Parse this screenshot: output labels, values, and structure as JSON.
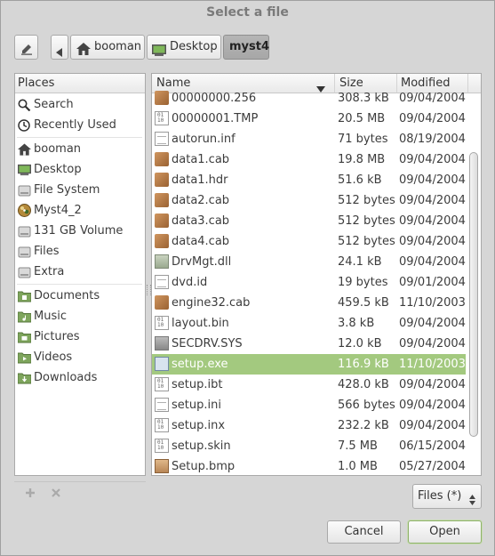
{
  "window": {
    "title": "Select a file"
  },
  "pathbar": {
    "edit_icon": "pencil-icon",
    "back_icon": "left-arrow-icon",
    "crumbs": [
      {
        "label": "booman",
        "icon": "home-icon"
      },
      {
        "label": "Desktop",
        "icon": "desktop-icon"
      },
      {
        "label": "myst4",
        "icon": ""
      }
    ]
  },
  "places": {
    "header": "Places",
    "items": [
      {
        "label": "Search",
        "icon": "search-icon"
      },
      {
        "label": "Recently Used",
        "icon": "clock-icon"
      },
      {
        "label": "booman",
        "icon": "home-icon"
      },
      {
        "label": "Desktop",
        "icon": "desktop-icon"
      },
      {
        "label": "File System",
        "icon": "drive-icon"
      },
      {
        "label": "Myst4_2",
        "icon": "disc-icon"
      },
      {
        "label": "131 GB Volume",
        "icon": "drive-icon"
      },
      {
        "label": "Files",
        "icon": "drive-icon"
      },
      {
        "label": "Extra",
        "icon": "drive-icon"
      },
      {
        "label": "Documents",
        "icon": "documents-folder-icon"
      },
      {
        "label": "Music",
        "icon": "music-folder-icon"
      },
      {
        "label": "Pictures",
        "icon": "pictures-folder-icon"
      },
      {
        "label": "Videos",
        "icon": "videos-folder-icon"
      },
      {
        "label": "Downloads",
        "icon": "downloads-folder-icon"
      }
    ],
    "add_icon": "plus-icon",
    "remove_icon": "x-icon"
  },
  "files": {
    "columns": {
      "name": "Name",
      "size": "Size",
      "modified": "Modified"
    },
    "sort_icon": "sort-down-icon",
    "rows": [
      {
        "name": "00000000.256",
        "size": "308.3 kB",
        "modified": "09/04/2004",
        "icon": "archive-icon"
      },
      {
        "name": "00000001.TMP",
        "size": "20.5 MB",
        "modified": "09/04/2004",
        "icon": "binary-file-icon"
      },
      {
        "name": "autorun.inf",
        "size": "71 bytes",
        "modified": "08/19/2004",
        "icon": "text-file-icon"
      },
      {
        "name": "data1.cab",
        "size": "19.8 MB",
        "modified": "09/04/2004",
        "icon": "archive-icon"
      },
      {
        "name": "data1.hdr",
        "size": "51.6 kB",
        "modified": "09/04/2004",
        "icon": "archive-icon"
      },
      {
        "name": "data2.cab",
        "size": "512 bytes",
        "modified": "09/04/2004",
        "icon": "archive-icon"
      },
      {
        "name": "data3.cab",
        "size": "512 bytes",
        "modified": "09/04/2004",
        "icon": "archive-icon"
      },
      {
        "name": "data4.cab",
        "size": "512 bytes",
        "modified": "09/04/2004",
        "icon": "archive-icon"
      },
      {
        "name": "DrvMgt.dll",
        "size": "24.1 kB",
        "modified": "09/04/2004",
        "icon": "library-file-icon"
      },
      {
        "name": "dvd.id",
        "size": "19 bytes",
        "modified": "09/01/2004",
        "icon": "text-file-icon"
      },
      {
        "name": "engine32.cab",
        "size": "459.5 kB",
        "modified": "11/10/2003",
        "icon": "archive-icon"
      },
      {
        "name": "layout.bin",
        "size": "3.8 kB",
        "modified": "09/04/2004",
        "icon": "binary-file-icon"
      },
      {
        "name": "SECDRV.SYS",
        "size": "12.0 kB",
        "modified": "09/04/2004",
        "icon": "system-file-icon"
      },
      {
        "name": "setup.exe",
        "size": "116.9 kB",
        "modified": "11/10/2003",
        "icon": "executable-icon",
        "selected": true
      },
      {
        "name": "setup.ibt",
        "size": "428.0 kB",
        "modified": "09/04/2004",
        "icon": "binary-file-icon"
      },
      {
        "name": "setup.ini",
        "size": "566 bytes",
        "modified": "09/04/2004",
        "icon": "text-file-icon"
      },
      {
        "name": "setup.inx",
        "size": "232.2 kB",
        "modified": "09/04/2004",
        "icon": "binary-file-icon"
      },
      {
        "name": "setup.skin",
        "size": "7.5 MB",
        "modified": "06/15/2004",
        "icon": "binary-file-icon"
      },
      {
        "name": "Setup.bmp",
        "size": "1.0 MB",
        "modified": "05/27/2004",
        "icon": "image-file-icon"
      }
    ]
  },
  "filter": {
    "value": "Files (*)",
    "icon": "updown-icon"
  },
  "buttons": {
    "cancel": "Cancel",
    "open": "Open"
  },
  "colors": {
    "selection": "#a3c97f",
    "window_bg": "#d6d6d6"
  }
}
